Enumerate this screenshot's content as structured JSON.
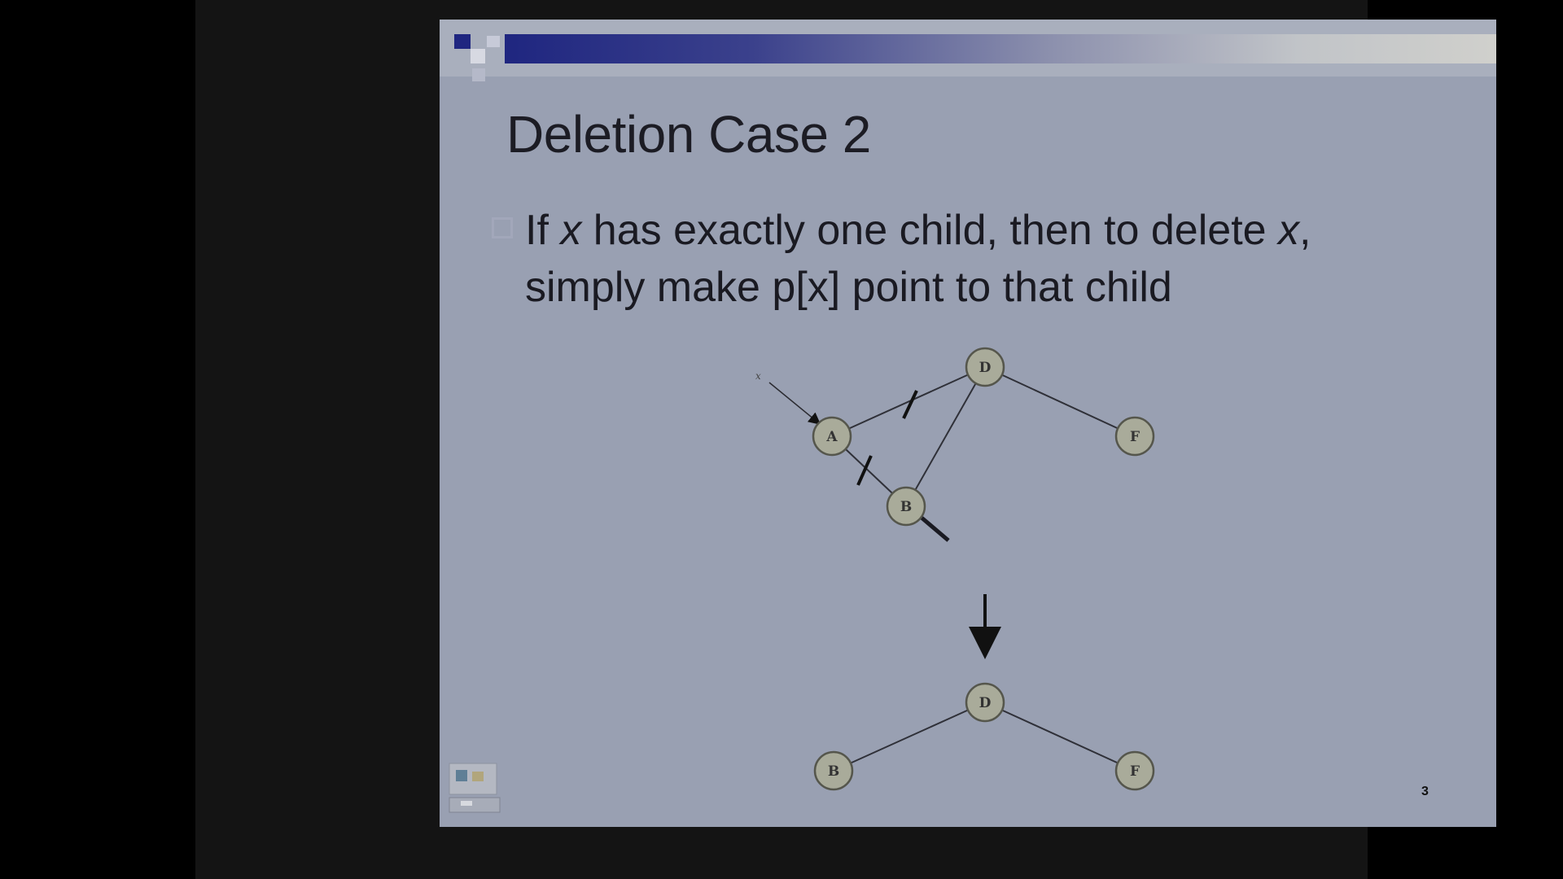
{
  "slide": {
    "title": "Deletion Case 2",
    "bullet": {
      "part1": "If ",
      "x1": "x",
      "part2": " has exactly one child, then to delete ",
      "x2": "x",
      "part3": ",",
      "line2": "simply make p[x] point to that child"
    },
    "page_number": "3"
  },
  "diagram": {
    "before_nodes": [
      "D",
      "A",
      "B",
      "F"
    ],
    "after_nodes": [
      "D",
      "B",
      "F"
    ],
    "pointer_label": "x"
  },
  "colors": {
    "slide_background": "#99a0b2",
    "node_fill": "#a9ab9a",
    "node_stroke": "#55564c",
    "banner_dark": "#1f2680"
  }
}
